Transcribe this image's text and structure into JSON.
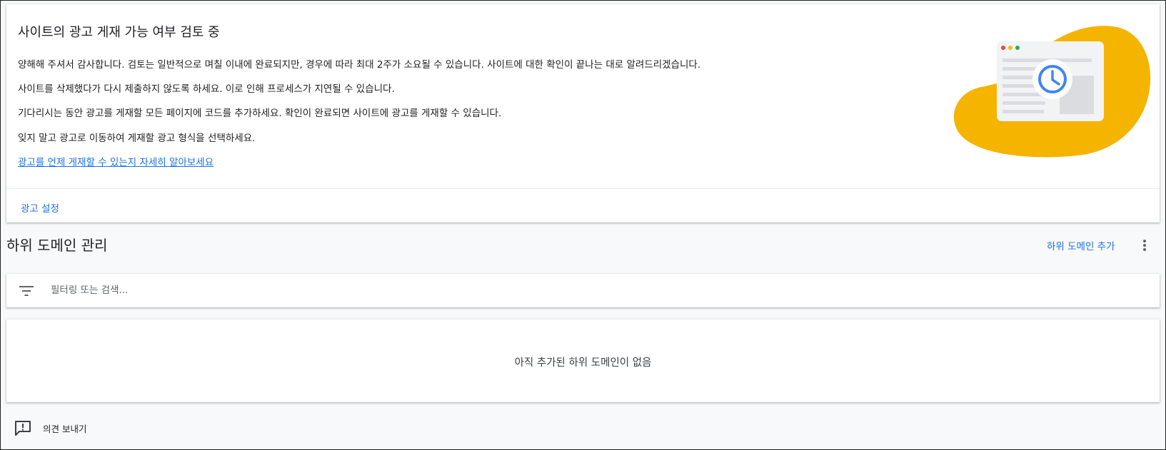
{
  "review": {
    "title": "사이트의 광고 게재 가능 여부 검토 중",
    "paragraphs": [
      "양해해 주셔서 감사합니다. 검토는 일반적으로 며칠 이내에 완료되지만, 경우에 따라 최대 2주가 소요될 수 있습니다. 사이트에 대한 확인이 끝나는 대로 알려드리겠습니다.",
      "사이트를 삭제했다가 다시 제출하지 않도록 하세요. 이로 인해 프로세스가 지연될 수 있습니다.",
      "기다리시는 동안 광고를 게재할 모든 페이지에 코드를 추가하세요. 확인이 완료되면 사이트에 광고를 게재할 수 있습니다.",
      "잊지 말고 광고로 이동하여 게재할 광고 형식을 선택하세요."
    ],
    "learn_more_link": "광고를 언제 게재할 수 있는지 자세히 알아보세요",
    "ad_settings_link": "광고 설정",
    "illustration_icon": "clock-browser-illustration"
  },
  "subdomains": {
    "title": "하위 도메인 관리",
    "add_button": "하위 도메인 추가",
    "more_icon": "more-vert-icon",
    "filter": {
      "icon": "filter-icon",
      "placeholder": "필터링 또는 검색...",
      "value": ""
    },
    "empty_message": "아직 추가된 하위 도메인이 없음"
  },
  "feedback": {
    "icon": "feedback-icon",
    "label": "의견 보내기"
  },
  "colors": {
    "accent": "#1a73e8",
    "illustration_yellow": "#f4b400",
    "clock_blue": "#4285f4"
  }
}
